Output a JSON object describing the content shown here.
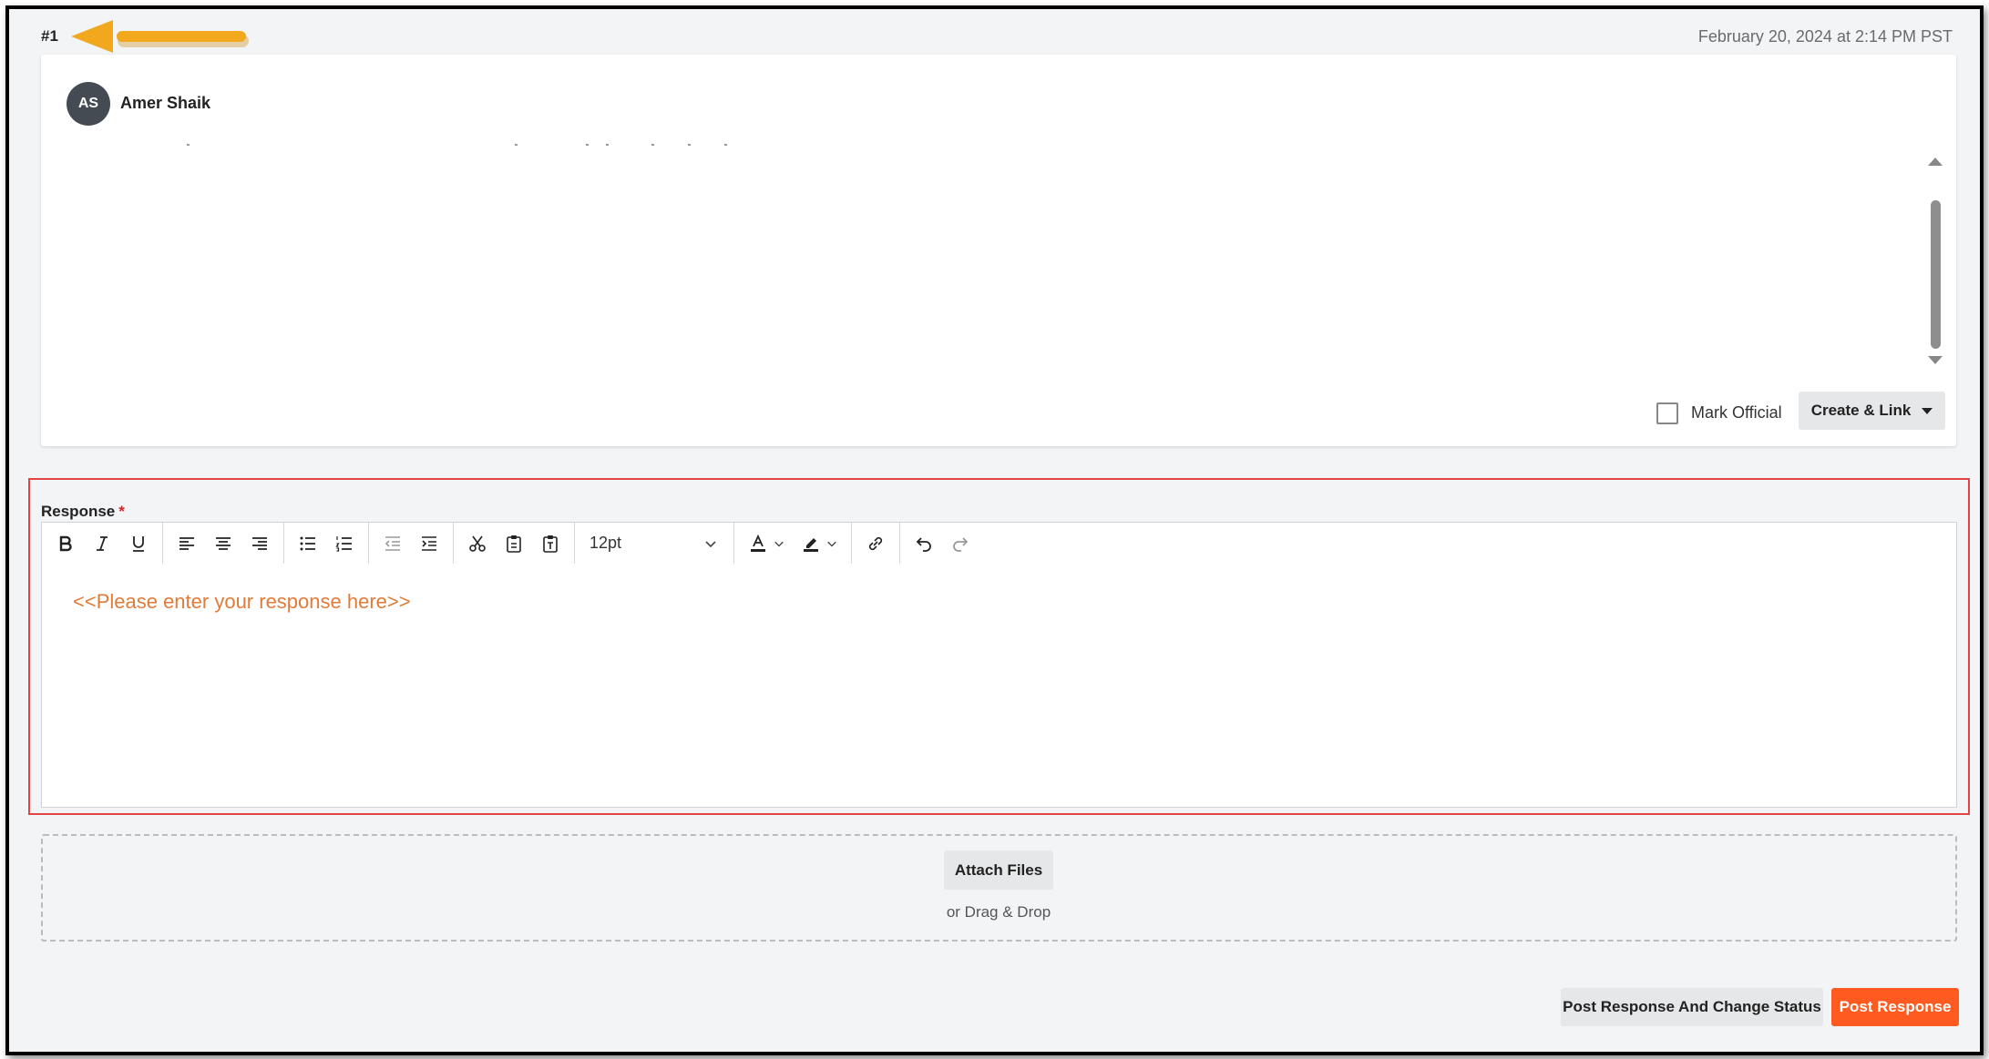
{
  "post": {
    "number": "#1",
    "timestamp": "February 20, 2024 at 2:14 PM PST",
    "author_initials": "AS",
    "author_name": "Amer Shaik"
  },
  "card_actions": {
    "mark_official_label": "Mark Official",
    "create_link_label": "Create & Link"
  },
  "response": {
    "label": "Response",
    "required_mark": "*",
    "placeholder": "<<Please enter your response here>>",
    "font_size": "12pt"
  },
  "toolbar": {
    "icons": [
      "bold-icon",
      "italic-icon",
      "underline-icon",
      "align-left-icon",
      "align-center-icon",
      "align-right-icon",
      "bullet-list-icon",
      "numbered-list-icon",
      "outdent-icon",
      "indent-icon",
      "cut-icon",
      "copy-icon",
      "paste-text-icon",
      "font-color-icon",
      "highlight-color-icon",
      "link-icon",
      "undo-icon",
      "redo-icon"
    ]
  },
  "attachments": {
    "button_label": "Attach Files",
    "drag_text": "or Drag & Drop"
  },
  "footer": {
    "secondary_label": "Post Response And Change Status",
    "primary_label": "Post Response"
  },
  "colors": {
    "accent": "#ff5a1f",
    "placeholder": "#e07b39",
    "highlight_box": "#e24444",
    "annotation_arrow": "#f2a81d"
  }
}
